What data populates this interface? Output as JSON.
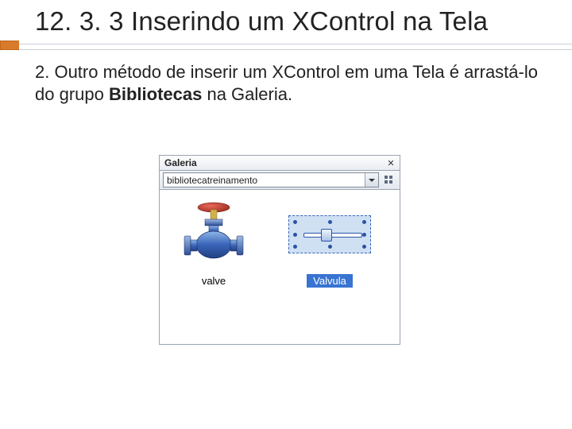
{
  "heading": "12. 3. 3 Inserindo um XControl na Tela",
  "body": {
    "prefix": "2. Outro método de inserir um XControl em uma Tela é arrastá-lo do grupo ",
    "bold": "Bibliotecas",
    "suffix": " na Galeria."
  },
  "panel": {
    "title": "Galeria",
    "dropdown_value": "bibliotecatreinamento",
    "items": [
      {
        "label": "valve",
        "selected": false,
        "kind": "valve"
      },
      {
        "label": "Valvula",
        "selected": true,
        "kind": "gauge"
      }
    ]
  }
}
